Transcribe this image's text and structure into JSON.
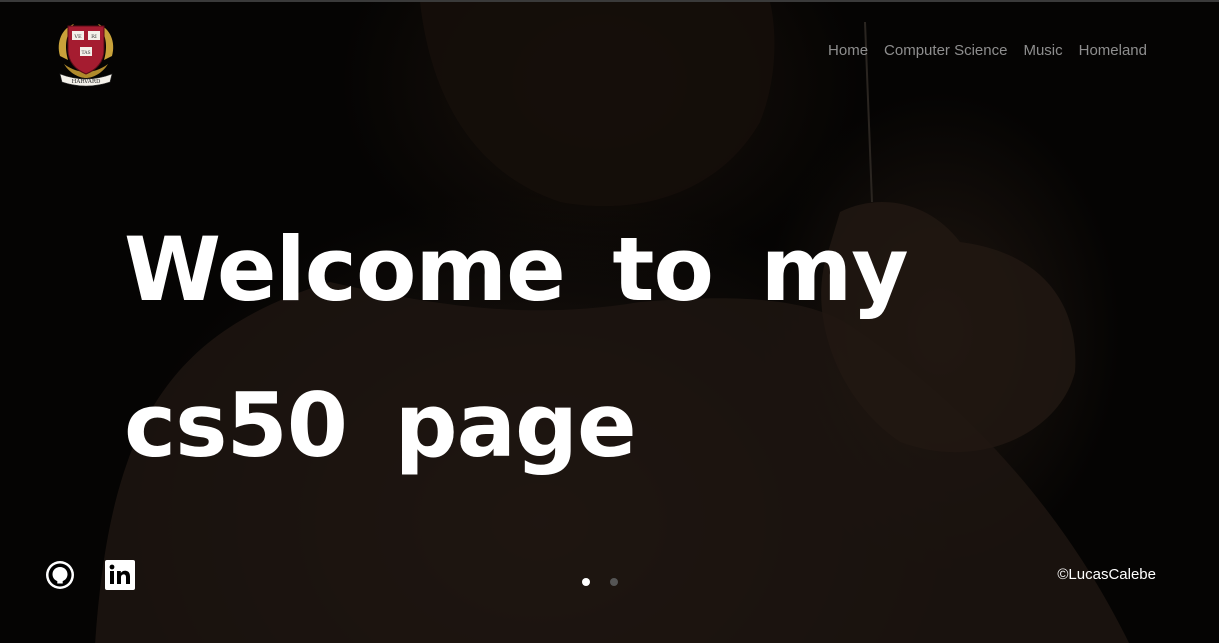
{
  "header": {
    "logo_text": "HARVARD",
    "logo_shield": [
      "VE",
      "RI",
      "TAS"
    ],
    "nav": [
      {
        "label": "Home"
      },
      {
        "label": "Computer Science"
      },
      {
        "label": "Music"
      },
      {
        "label": "Homeland"
      }
    ]
  },
  "hero": {
    "title": "Welcome to my cs50 page"
  },
  "carousel": {
    "slides": 2,
    "active_index": 0
  },
  "footer": {
    "social": [
      {
        "icon": "github-icon"
      },
      {
        "icon": "linkedin-icon"
      }
    ],
    "copyright": "©LucasCalebe"
  },
  "colors": {
    "background": "#050403",
    "text": "#ffffff",
    "nav_text": "#8e8e8e",
    "shield_red": "#a51c30",
    "laurel_gold": "#c9a23a"
  }
}
